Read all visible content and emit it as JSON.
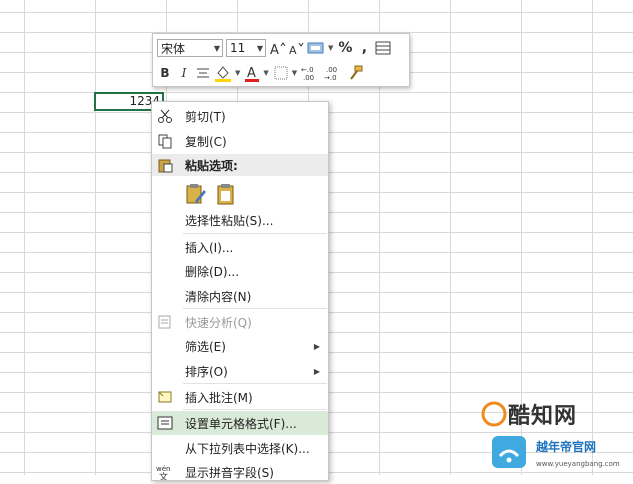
{
  "cell": {
    "value": "1234"
  },
  "mini_toolbar": {
    "font_name": "宋体",
    "font_size": "11",
    "percent": "%",
    "comma": ",",
    "bold": "B",
    "italic": "I",
    "colors": {
      "highlight": "#ffd400",
      "font": "#e02020"
    }
  },
  "menu": {
    "cut": "剪切(T)",
    "copy": "复制(C)",
    "paste_options": "粘贴选项:",
    "paste_special": "选择性粘贴(S)...",
    "insert": "插入(I)...",
    "delete": "删除(D)...",
    "clear": "清除内容(N)",
    "quick_analysis": "快速分析(Q)",
    "filter": "筛选(E)",
    "sort": "排序(O)",
    "insert_comment": "插入批注(M)",
    "format_cells": "设置单元格格式(F)...",
    "pick_list": "从下拉列表中选择(K)...",
    "phonetic": "显示拼音字段(S)"
  },
  "watermark": {
    "title": "酷知网",
    "subtitle": "越年帝官网",
    "url": "www.yueyangbang.com"
  }
}
